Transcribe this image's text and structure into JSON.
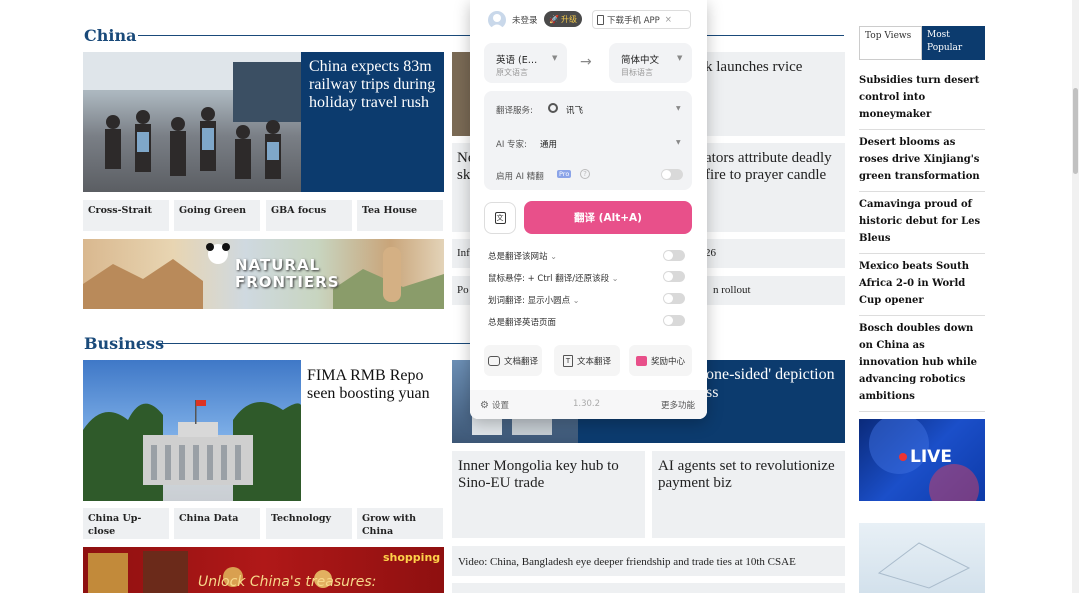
{
  "china": {
    "title": "China",
    "lead": "China expects 83m railway trips during holiday travel rush",
    "tiles": [
      "Cross-Strait",
      "Going Green",
      "GBA focus",
      "Tea House"
    ],
    "banner": "NATURAL FRONTIERS",
    "mid_head": "k launches rvice",
    "mid_text1_left": "Ne sk",
    "mid_text1_right": "ators attribute deadly fire to prayer candle",
    "mid_row2_left": "Inf",
    "mid_row2_right": "26",
    "mid_row3_left": "Po",
    "mid_row3_right": "n rollout"
  },
  "business": {
    "title": "Business",
    "lead": "FIMA RMB Repo seen boosting yuan",
    "mid_head": "one-sided' depiction ss",
    "tiles": [
      "China Up-close",
      "China Data",
      "Technology",
      "Grow with China"
    ],
    "banner": "Unlock China's treasures:",
    "banner_logo": "shopping",
    "card1": "Inner Mongolia key hub to Sino-EU trade",
    "card2": "AI agents set to revolutionize payment biz",
    "video": "Video: China, Bangladesh eye deeper friendship and trade ties at 10th CSAE"
  },
  "sidebar": {
    "tab_top": "Top Views",
    "tab_popular": "Most Popular",
    "items": [
      "Subsidies turn desert control into moneymaker",
      "Desert blooms as roses drive Xinjiang's green transformation",
      "Camavinga proud of historic debut for Les Bleus",
      "Mexico beats South Africa 2-0 in World Cup opener",
      "Bosch doubles down on China as innovation hub while advancing robotics ambitions"
    ],
    "live": "LIVE"
  },
  "popup": {
    "login": "未登录",
    "upgrade": "升级",
    "download": "下载手机 APP",
    "src_lang": "英语 (E…",
    "src_sub": "原文语言",
    "tgt_lang": "简体中文",
    "tgt_sub": "目标语言",
    "service_label": "翻译服务:",
    "service_value": "讯飞",
    "expert_label": "AI 专家:",
    "expert_value": "通用",
    "ai_enhance": "启用 AI 精翻",
    "pro": "Pro",
    "translate_btn": "翻译 (Alt+A)",
    "opt1": "总是翻译该网站",
    "opt2": "鼠标悬停: + Ctrl 翻译/还原该段",
    "opt3": "划词翻译: 显示小圆点",
    "opt4": "总是翻译英语页面",
    "tool1": "文档翻译",
    "tool2": "文本翻译",
    "tool3": "奖励中心",
    "settings": "设置",
    "version": "1.30.2",
    "more": "更多功能",
    "accent": "#e8508a"
  }
}
